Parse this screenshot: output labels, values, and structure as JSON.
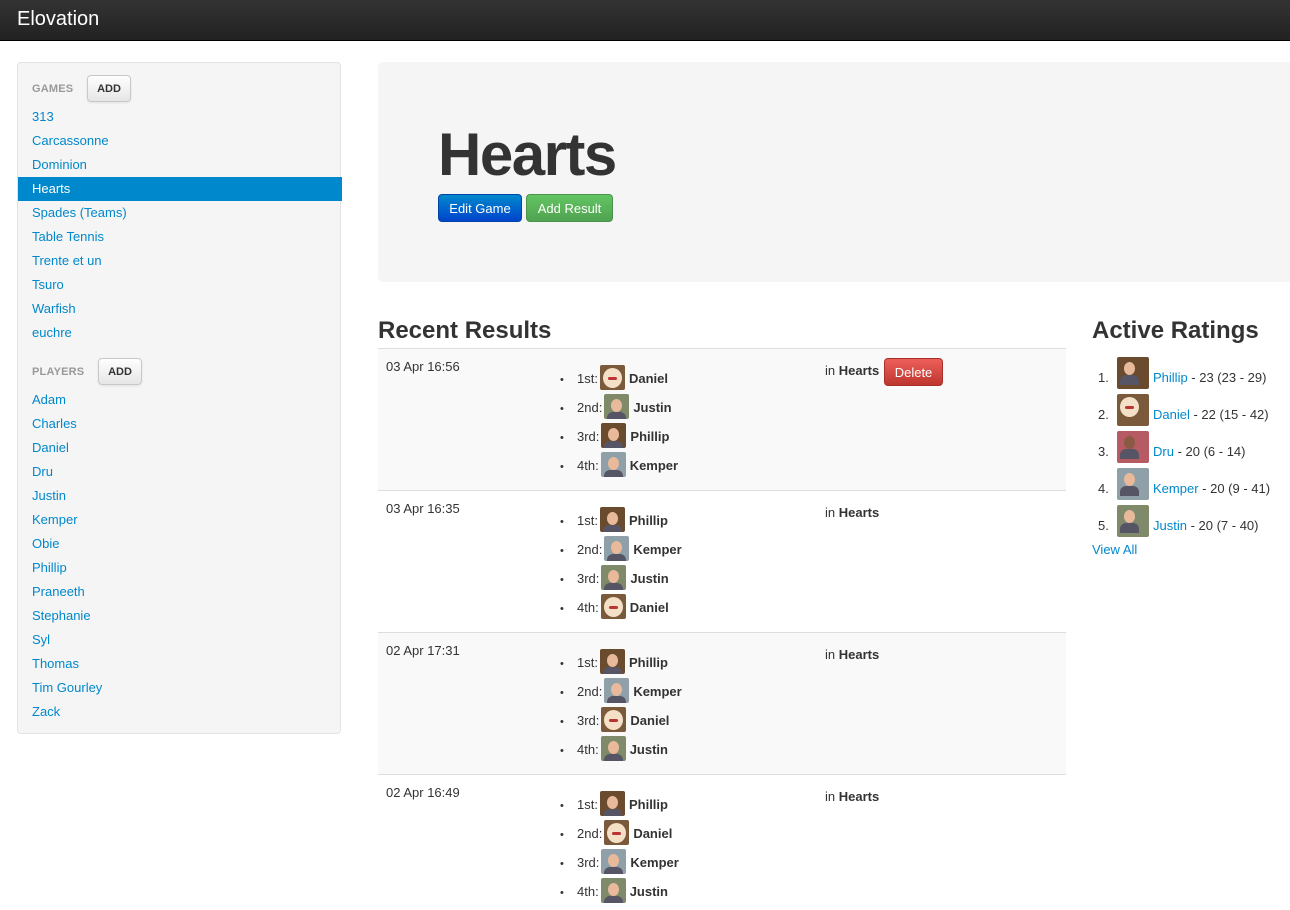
{
  "navbar": {
    "brand": "Elovation"
  },
  "sidebar": {
    "games_header": "GAMES",
    "games_add": "ADD",
    "games": [
      "313",
      "Carcassonne",
      "Dominion",
      "Hearts",
      "Spades (Teams)",
      "Table Tennis",
      "Trente et un",
      "Tsuro",
      "Warfish",
      "euchre"
    ],
    "active_game": "Hearts",
    "players_header": "PLAYERS",
    "players_add": "ADD",
    "players": [
      "Adam",
      "Charles",
      "Daniel",
      "Dru",
      "Justin",
      "Kemper",
      "Obie",
      "Phillip",
      "Praneeth",
      "Stephanie",
      "Syl",
      "Thomas",
      "Tim Gourley",
      "Zack"
    ]
  },
  "hero": {
    "title": "Hearts",
    "edit_label": "Edit Game",
    "add_result_label": "Add Result"
  },
  "recent": {
    "title": "Recent Results",
    "in_label": "in",
    "delete_label": "Delete",
    "results": [
      {
        "time": "03 Apr 16:56",
        "game": "Hearts",
        "placings": [
          {
            "place": "1st:",
            "player": "Daniel",
            "avatar": "daniel"
          },
          {
            "place": "2nd:",
            "player": "Justin",
            "avatar": "justin"
          },
          {
            "place": "3rd:",
            "player": "Phillip",
            "avatar": "phillip"
          },
          {
            "place": "4th:",
            "player": "Kemper",
            "avatar": "kemper"
          }
        ]
      },
      {
        "time": "03 Apr 16:35",
        "game": "Hearts",
        "placings": [
          {
            "place": "1st:",
            "player": "Phillip",
            "avatar": "phillip"
          },
          {
            "place": "2nd:",
            "player": "Kemper",
            "avatar": "kemper"
          },
          {
            "place": "3rd:",
            "player": "Justin",
            "avatar": "justin"
          },
          {
            "place": "4th:",
            "player": "Daniel",
            "avatar": "daniel"
          }
        ]
      },
      {
        "time": "02 Apr 17:31",
        "game": "Hearts",
        "placings": [
          {
            "place": "1st:",
            "player": "Phillip",
            "avatar": "phillip"
          },
          {
            "place": "2nd:",
            "player": "Kemper",
            "avatar": "kemper"
          },
          {
            "place": "3rd:",
            "player": "Daniel",
            "avatar": "daniel"
          },
          {
            "place": "4th:",
            "player": "Justin",
            "avatar": "justin"
          }
        ]
      },
      {
        "time": "02 Apr 16:49",
        "game": "Hearts",
        "placings": [
          {
            "place": "1st:",
            "player": "Phillip",
            "avatar": "phillip"
          },
          {
            "place": "2nd:",
            "player": "Daniel",
            "avatar": "daniel"
          },
          {
            "place": "3rd:",
            "player": "Kemper",
            "avatar": "kemper"
          },
          {
            "place": "4th:",
            "player": "Justin",
            "avatar": "justin"
          }
        ]
      }
    ]
  },
  "ratings": {
    "title": "Active Ratings",
    "view_all": "View All",
    "items": [
      {
        "num": "1.",
        "player": "Phillip",
        "detail": " - 23 (23 - 29)",
        "avatar": "phillip"
      },
      {
        "num": "2.",
        "player": "Daniel",
        "detail": " - 22 (15 - 42)",
        "avatar": "daniel"
      },
      {
        "num": "3.",
        "player": "Dru",
        "detail": " - 20 (6 - 14)",
        "avatar": "dru"
      },
      {
        "num": "4.",
        "player": "Kemper",
        "detail": " - 20 (9 - 41)",
        "avatar": "kemper"
      },
      {
        "num": "5.",
        "player": "Justin",
        "detail": " - 20 (7 - 40)",
        "avatar": "justin"
      }
    ]
  }
}
